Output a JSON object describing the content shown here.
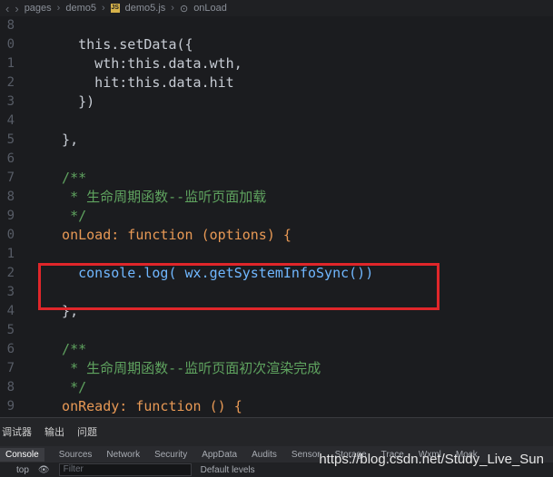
{
  "breadcrumb": {
    "items": [
      "pages",
      "demo5",
      "demo5.js",
      "onLoad"
    ]
  },
  "editor": {
    "line_numbers": [
      "8",
      "0",
      "1",
      "2",
      "3",
      "4",
      "5",
      "6",
      "7",
      "8",
      "9",
      "0",
      "1",
      "2",
      "3",
      "4",
      "5",
      "6",
      "7",
      "8",
      "9"
    ],
    "lines": [
      "    this.setData({",
      "      wth:this.data.wth,",
      "      hit:this.data.hit",
      "    })",
      "",
      "  },",
      "",
      "  /**",
      "   * 生命周期函数--监听页面加载",
      "   */",
      "  onLoad: function (options) {",
      "",
      "    console.log( wx.getSystemInfoSync())",
      "",
      "  },",
      "",
      "  /**",
      "   * 生命周期函数--监听页面初次渲染完成",
      "   */",
      "  onReady: function () {"
    ]
  },
  "panel": {
    "tabs": [
      "调试器",
      "输出",
      "问题"
    ]
  },
  "devtools": {
    "tabs": [
      "Console",
      "Sources",
      "Network",
      "Security",
      "AppData",
      "Audits",
      "Sensor",
      "Storage",
      "Trace",
      "Wxml",
      "Mock"
    ],
    "context": "top",
    "filter_placeholder": "Filter",
    "levels": "Default levels"
  },
  "watermark": "https://blog.csdn.net/Study_Live_Sun",
  "colors": {
    "highlight_border": "#e0262a"
  }
}
